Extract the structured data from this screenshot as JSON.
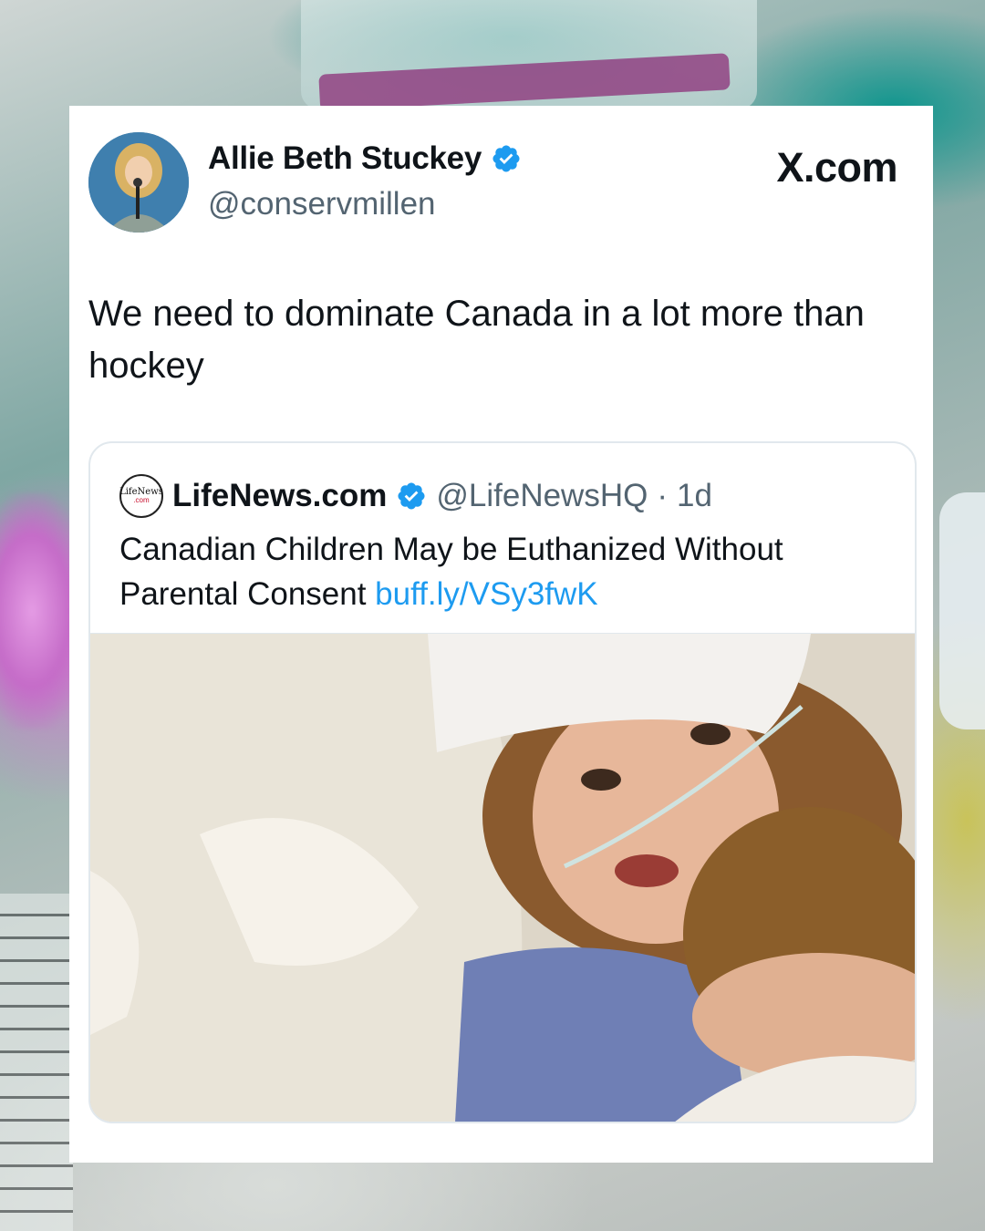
{
  "post": {
    "author_name": "Allie Beth Stuckey",
    "author_handle": "@conservmillen",
    "site_label": "X.com",
    "text": "We need to dominate Canada in a lot more than hockey"
  },
  "quoted": {
    "logo_top": "LifeNews",
    "logo_bottom": ".com",
    "author_name": "LifeNews.com",
    "author_handle": "@LifeNewsHQ",
    "separator": "·",
    "age": "1d",
    "text": "Canadian Children May be Euthanized Without Parental Consent ",
    "link": "buff.ly/VSy3fwK"
  },
  "colors": {
    "verified": "#1d9bf0",
    "link": "#1d9bf0",
    "text": "#0f1419",
    "muted": "#536471"
  },
  "icons": {
    "verified": "verified-badge-icon",
    "x_logo": "x-logo"
  }
}
